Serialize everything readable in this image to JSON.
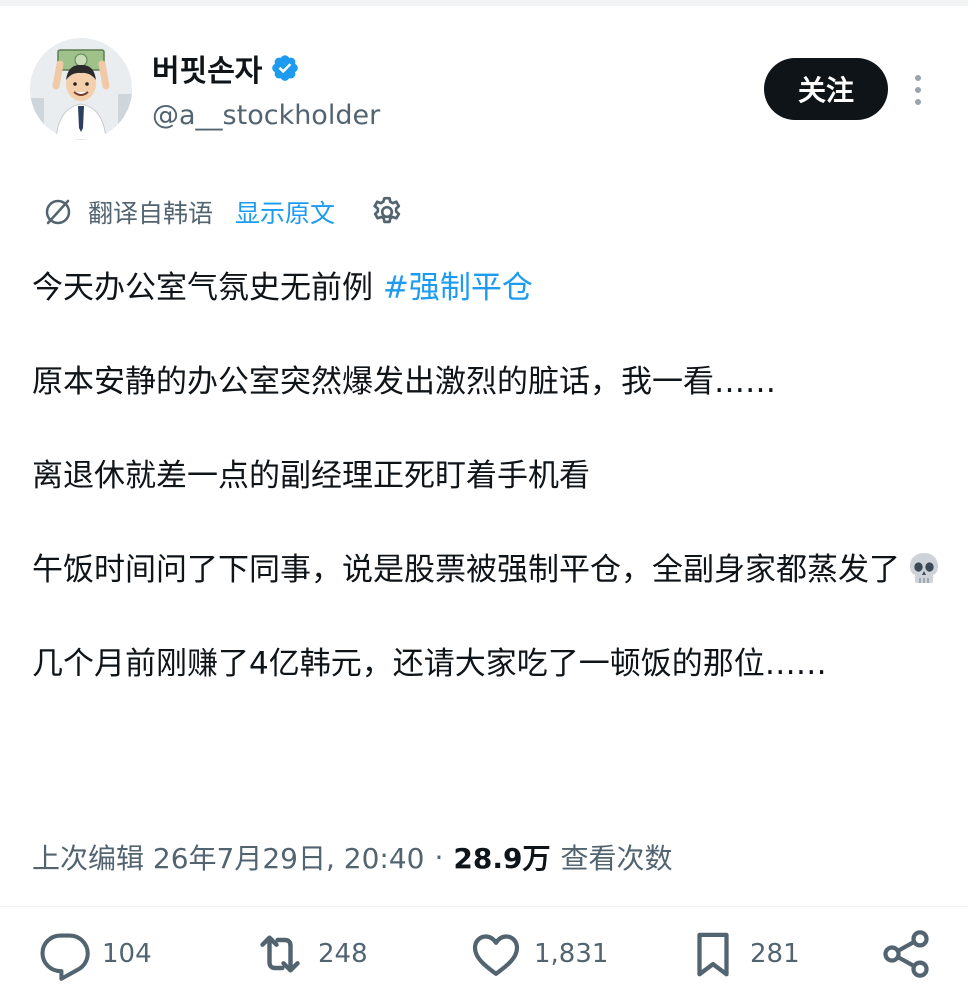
{
  "user": {
    "display_name": "버핏손자",
    "handle": "@a__stockholder",
    "verified_icon": "verified-badge-icon",
    "avatar_icon": "avatar-cartoon-man-holding-dollar"
  },
  "header": {
    "follow_label": "关注",
    "more_icon": "more-vertical-icon"
  },
  "translation": {
    "label": "翻译自韩语",
    "show_original": "显示原文",
    "icon": "translate-icon",
    "settings_icon": "gear-icon"
  },
  "tweet": {
    "p1_text": "今天办公室气氛史无前例 ",
    "p1_hashtag": "#强制平仓",
    "p2": "原本安静的办公室突然爆发出激烈的脏话，我一看……",
    "p3": "离退休就差一点的副经理正死盯着手机看",
    "p4": "午饭时间问了下同事，说是股票被强制平仓，全副身家都蒸发了",
    "p4_emoji": "skull-emoji",
    "p5": "几个月前刚赚了4亿韩元，还请大家吃了一顿饭的那位……"
  },
  "meta": {
    "edited_time": "上次编辑 26年7月29日, 20:40",
    "separator": "·",
    "views_count": "28.9万",
    "views_label": "查看次数"
  },
  "actions": {
    "replies": "104",
    "retweets": "248",
    "likes": "1,831",
    "bookmarks": "281"
  },
  "colors": {
    "accent": "#1d9bf0",
    "text": "#0f1419",
    "muted": "#536471",
    "button_bg": "#0f1419"
  }
}
